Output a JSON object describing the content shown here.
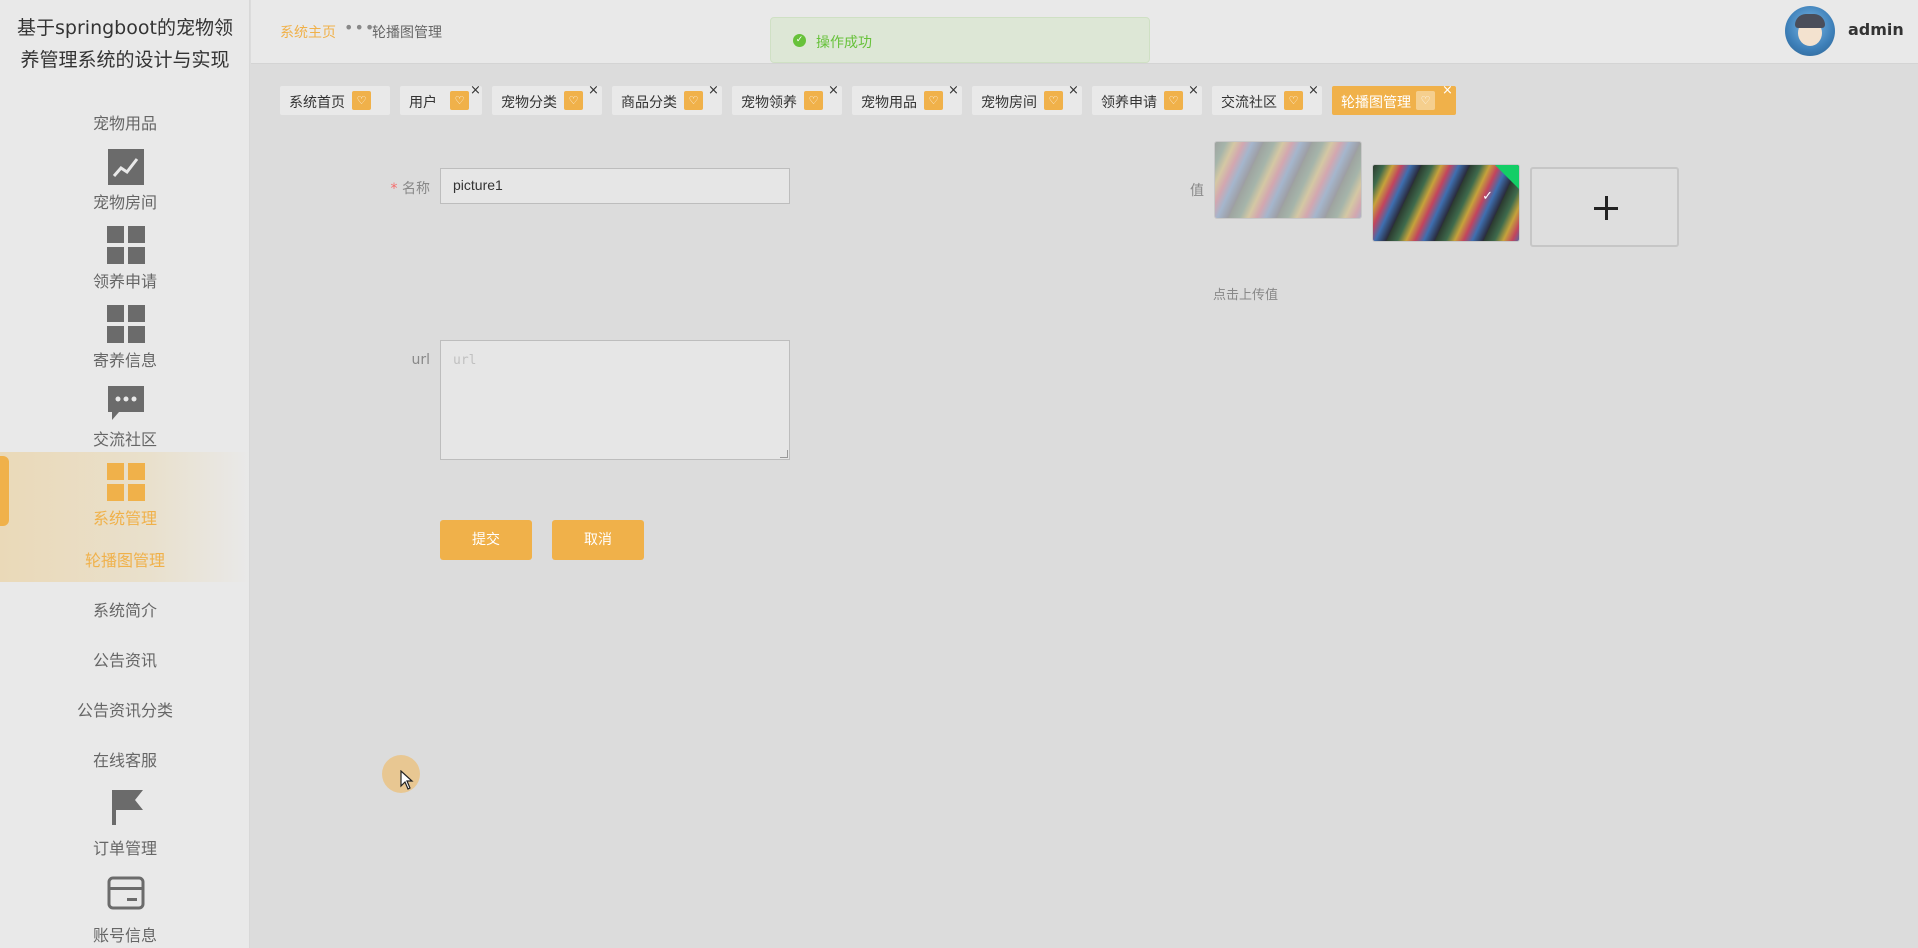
{
  "app": {
    "title_line1": "基于springboot的宠物领",
    "title_line2": "养管理系统的设计与实现"
  },
  "sidebar": {
    "items": [
      {
        "label": "宠物用品",
        "icon": "none"
      },
      {
        "label": "宠物房间",
        "icon": "line-chart-icon"
      },
      {
        "label": "领养申请",
        "icon": "grid-icon"
      },
      {
        "label": "寄养信息",
        "icon": "grid-icon"
      },
      {
        "label": "交流社区",
        "icon": "chat-icon"
      },
      {
        "label": "系统管理",
        "icon": "grid-icon",
        "active": true
      },
      {
        "label": "轮播图管理",
        "icon": "none",
        "active": true
      },
      {
        "label": "系统简介",
        "icon": "none"
      },
      {
        "label": "公告资讯",
        "icon": "none"
      },
      {
        "label": "公告资讯分类",
        "icon": "none"
      },
      {
        "label": "在线客服",
        "icon": "none"
      },
      {
        "label": "订单管理",
        "icon": "flag-icon"
      },
      {
        "label": "账号信息",
        "icon": "card-icon"
      }
    ]
  },
  "header": {
    "breadcrumb_home": "系统主页",
    "breadcrumb_sep": "•••",
    "breadcrumb_current": "轮播图管理",
    "toast": "操作成功",
    "username": "admin"
  },
  "tags": [
    {
      "label": "系统首页",
      "closable": false
    },
    {
      "label": "用户",
      "closable": true
    },
    {
      "label": "宠物分类",
      "closable": true
    },
    {
      "label": "商品分类",
      "closable": true
    },
    {
      "label": "宠物领养",
      "closable": true
    },
    {
      "label": "宠物用品",
      "closable": true
    },
    {
      "label": "宠物房间",
      "closable": true
    },
    {
      "label": "领养申请",
      "closable": true
    },
    {
      "label": "交流社区",
      "closable": true
    },
    {
      "label": "轮播图管理",
      "closable": true,
      "active": true
    }
  ],
  "form": {
    "name_required_mark": "*",
    "name_label": "名称",
    "name_value": "picture1",
    "url_label": "url",
    "url_placeholder": "url",
    "value_label": "值",
    "upload_tip": "点击上传值",
    "submit_label": "提交",
    "cancel_label": "取消"
  },
  "colors": {
    "accent": "#f0b14a",
    "success": "#67c23a",
    "required": "#f56c6c"
  }
}
